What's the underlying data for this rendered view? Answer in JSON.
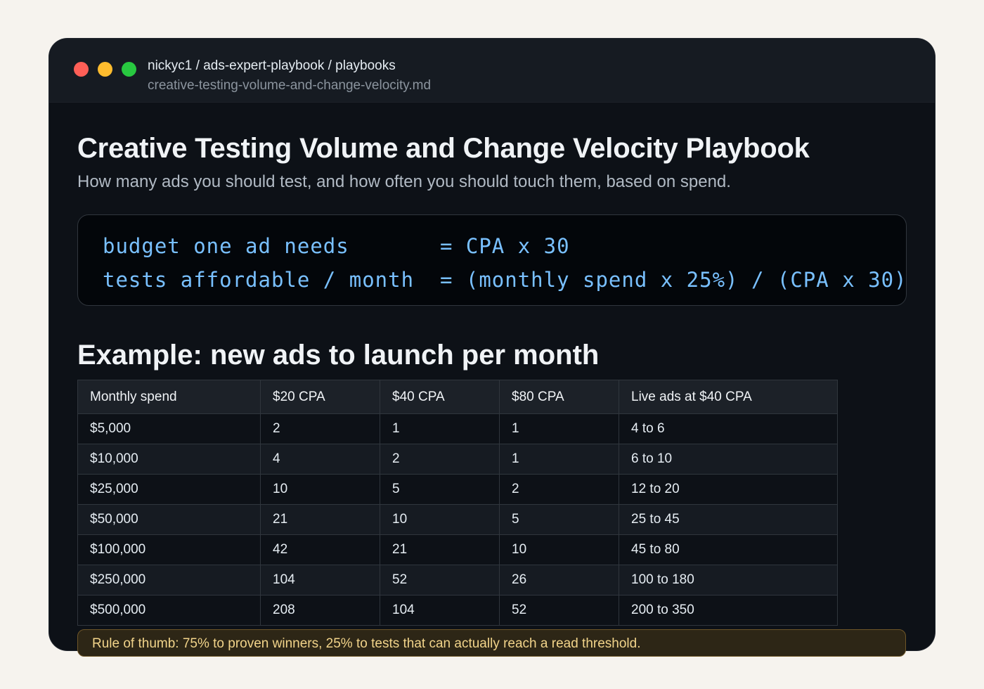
{
  "window": {
    "breadcrumb": "nickyc1 / ads-expert-playbook / playbooks",
    "filename": "creative-testing-volume-and-change-velocity.md"
  },
  "doc": {
    "title": "Creative Testing Volume and Change Velocity Playbook",
    "subtitle": "How many ads you should test, and how often you should touch them, based on spend.",
    "code_lines": [
      "budget one ad needs       = CPA x 30",
      "tests affordable / month  = (monthly spend x 25%) / (CPA x 30)"
    ],
    "section_title": "Example: new ads to launch per month",
    "table": {
      "headers": [
        "Monthly spend",
        "$20 CPA",
        "$40 CPA",
        "$80 CPA",
        "Live ads at $40 CPA"
      ],
      "rows": [
        [
          "$5,000",
          "2",
          "1",
          "1",
          "4 to 6"
        ],
        [
          "$10,000",
          "4",
          "2",
          "1",
          "6 to 10"
        ],
        [
          "$25,000",
          "10",
          "5",
          "2",
          "12 to 20"
        ],
        [
          "$50,000",
          "21",
          "10",
          "5",
          "25 to 45"
        ],
        [
          "$100,000",
          "42",
          "21",
          "10",
          "45 to 80"
        ],
        [
          "$250,000",
          "104",
          "52",
          "26",
          "100 to 180"
        ],
        [
          "$500,000",
          "208",
          "104",
          "52",
          "200 to 350"
        ]
      ]
    },
    "callout": "Rule of thumb: 75% to proven winners, 25% to tests that can actually reach a read threshold."
  },
  "colors": {
    "page_background": "#f6f3ee",
    "window_background": "#0d1117",
    "code_text": "#79c0ff",
    "callout_text": "#f2d48a"
  }
}
